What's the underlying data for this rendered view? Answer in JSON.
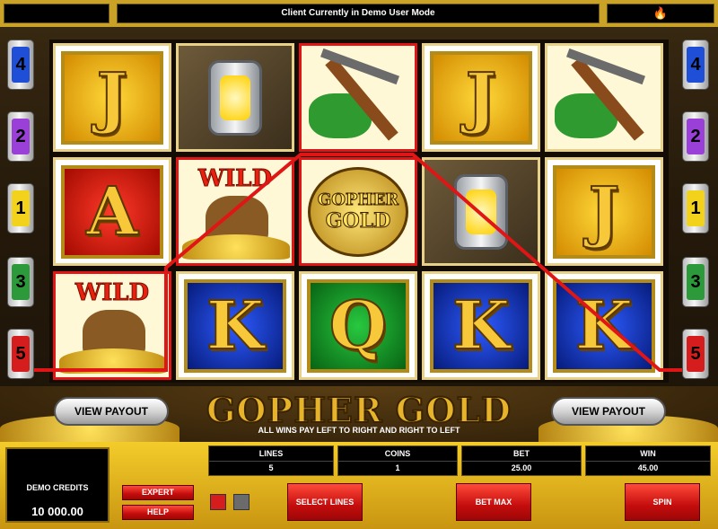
{
  "top_bar": {
    "status_text": "Client Currently in Demo User Mode",
    "right_icon": "flame-icon"
  },
  "line_markers": {
    "left": [
      {
        "number": "4",
        "color": "#1f4fd6"
      },
      {
        "number": "2",
        "color": "#9a3fd8"
      },
      {
        "number": "1",
        "color": "#f2d21a"
      },
      {
        "number": "3",
        "color": "#2c9a3a"
      },
      {
        "number": "5",
        "color": "#d61d1d"
      }
    ],
    "right": [
      {
        "number": "4",
        "color": "#1f4fd6"
      },
      {
        "number": "2",
        "color": "#9a3fd8"
      },
      {
        "number": "1",
        "color": "#f2d21a"
      },
      {
        "number": "3",
        "color": "#2c9a3a"
      },
      {
        "number": "5",
        "color": "#d61d1d"
      }
    ]
  },
  "reels": {
    "grid": [
      [
        "J",
        "lantern",
        "pickaxe",
        "J",
        "pickaxe"
      ],
      [
        "A",
        "wild",
        "gopher-gold",
        "lantern",
        "J"
      ],
      [
        "wild",
        "K",
        "Q",
        "K",
        "K"
      ]
    ],
    "wild_label": "WILD",
    "logo_text_top": "GOPHER",
    "logo_text_bottom": "GOLD",
    "winning_line_color": "#e01515"
  },
  "banner": {
    "title": "GOPHER GOLD",
    "subtitle": "ALL WINS PAY LEFT TO RIGHT AND RIGHT TO LEFT",
    "view_payout_left": "VIEW PAYOUT",
    "view_payout_right": "VIEW PAYOUT"
  },
  "panel": {
    "credits_label": "DEMO CREDITS",
    "credits_value": "10 000.00",
    "lines": {
      "label": "LINES",
      "value": "5"
    },
    "coins": {
      "label": "COINS",
      "value": "1"
    },
    "bet": {
      "label": "BET",
      "value": "25.00"
    },
    "win": {
      "label": "WIN",
      "value": "45.00"
    },
    "expert_label": "EXPERT",
    "help_label": "HELP",
    "select_lines_label": "SELECT LINES",
    "bet_max_label": "BET MAX",
    "spin_label": "SPIN"
  }
}
